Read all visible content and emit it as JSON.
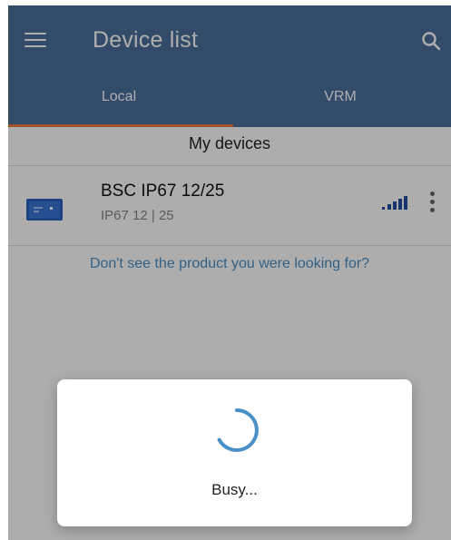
{
  "appbar": {
    "title": "Device list"
  },
  "tabs": [
    {
      "label": "Local",
      "selected": true
    },
    {
      "label": "VRM",
      "selected": false
    }
  ],
  "section": {
    "title": "My devices"
  },
  "devices": [
    {
      "name": "BSC IP67 12/25",
      "subtitle": "IP67 12 | 25"
    }
  ],
  "help_link": "Don't see the product you were looking for?",
  "dialog": {
    "message": "Busy..."
  },
  "colors": {
    "appbar": "#4a6f9b",
    "tab_indicator": "#f07a3c",
    "link": "#4a90c8",
    "spinner": "#4a90c8"
  },
  "icons": {
    "menu": "menu-icon",
    "search": "search-icon",
    "signal": "signal-strength-icon",
    "more": "more-vertical-icon"
  }
}
